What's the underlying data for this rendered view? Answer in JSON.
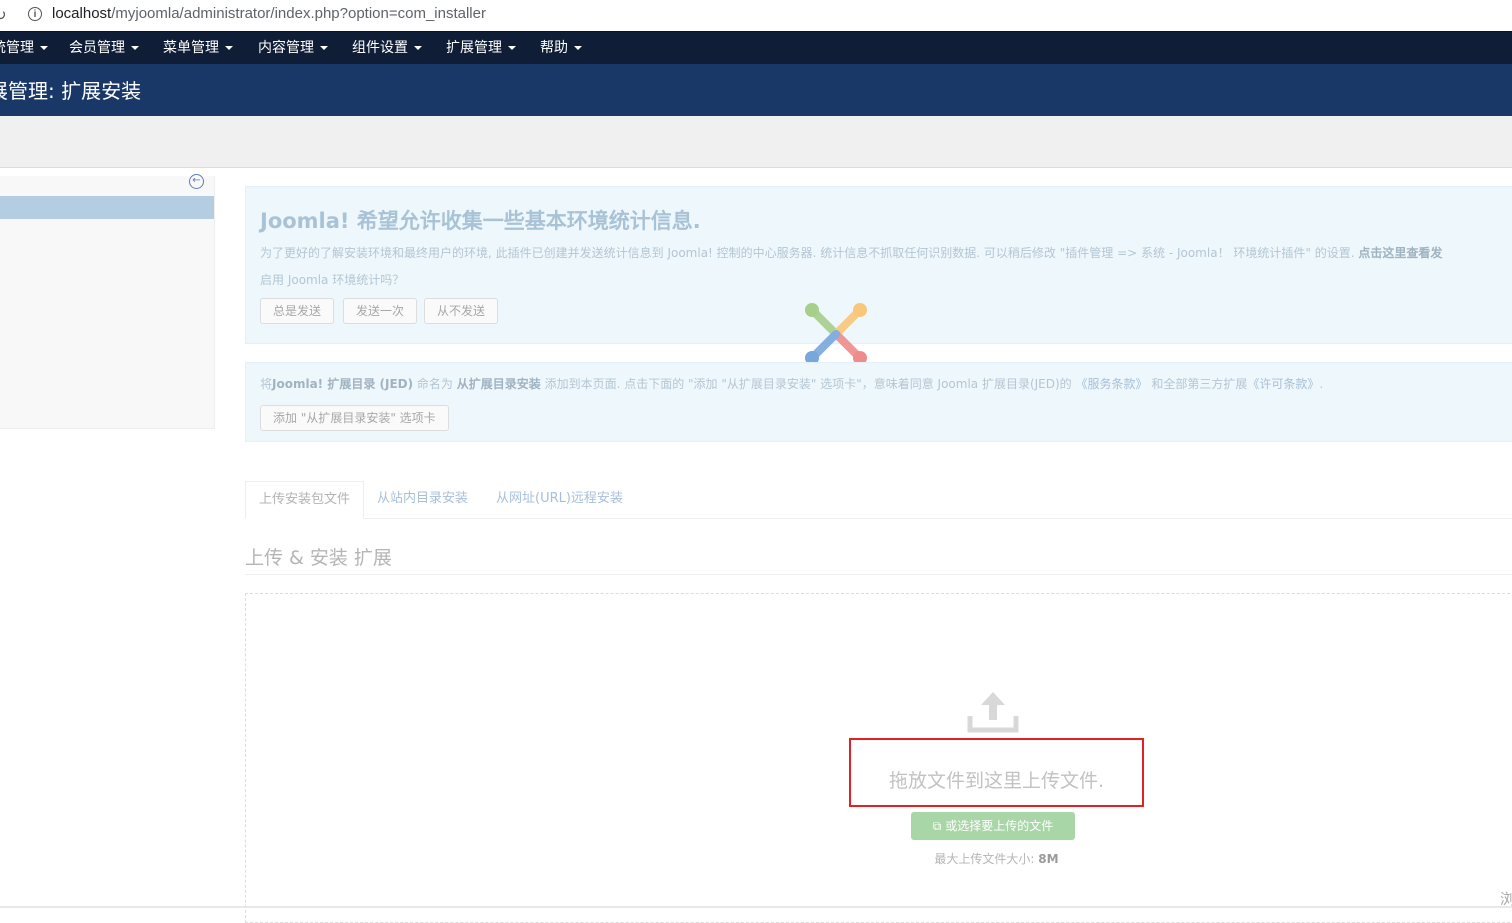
{
  "browser": {
    "url_host": "localhost",
    "url_path": "/myjoomla/administrator/index.php?option=com_installer"
  },
  "topnav": {
    "items": [
      "统管理",
      "会员管理",
      "菜单管理",
      "内容管理",
      "组件设置",
      "扩展管理",
      "帮助"
    ]
  },
  "header": {
    "title": "展管理: 扩展安装"
  },
  "stats_alert": {
    "heading": "Joomla! 希望允许收集一些基本环境统计信息.",
    "paragraph": "为了更好的了解安装环境和最终用户的环境, 此插件已创建并发送统计信息到 Joomla! 控制的中心服务器. 统计信息不抓取任何识别数据. 可以稍后修改 \"插件管理 => 系统 - Joomla！ 环境统计插件\" 的设置.",
    "paragraph_bold": "点击这里查看发",
    "question": "启用 Joomla 环境统计吗？",
    "buttons": [
      "总是发送",
      "发送一次",
      "从不发送"
    ]
  },
  "jed_alert": {
    "p1": "将",
    "b1": "Joomla! 扩展目录 (JED)",
    "p2": " 命名为 ",
    "b2": "从扩展目录安装",
    "p3": " 添加到本页面. 点击下面的 \"添加 \"从扩展目录安装\" 选项卡\"，意味着同意 Joomla 扩展目录(JED)的 ",
    "link1": "《服务条款》",
    "p4": " 和全部第三方扩展",
    "link2": "《许可条款》",
    "p5": ".",
    "button": "添加 \"从扩展目录安装\" 选项卡"
  },
  "tabs": [
    "上传安装包文件",
    "从站内目录安装",
    "从网址(URL)远程安装"
  ],
  "upload": {
    "section_title": "上传 & 安装 扩展",
    "drop_text": "拖放文件到这里上传文件.",
    "select_button": "或选择要上传的文件",
    "max_label": "最大上传文件大小: ",
    "max_value": "8M"
  },
  "corner_char": "浏",
  "colors": {
    "topnav_bg": "#0f1e36",
    "header_bg": "#1a3867",
    "alert_bg": "#eef7fc",
    "highlight_box": "#e22222",
    "select_button_bg": "#a9d6a6"
  }
}
